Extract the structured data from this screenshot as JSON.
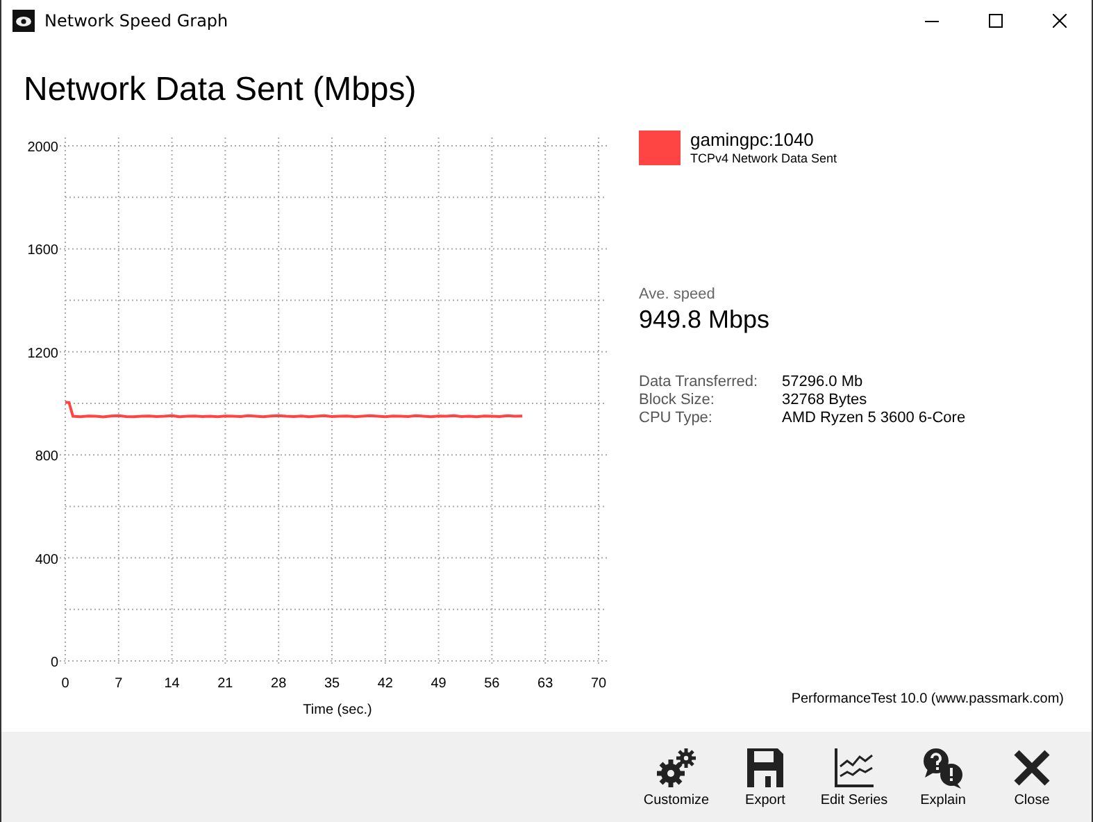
{
  "window": {
    "title": "Network Speed Graph"
  },
  "heading": "Network Data Sent (Mbps)",
  "chart": {
    "chart_data": {
      "type": "line",
      "grid": true,
      "xlabel": "Time (sec.)",
      "xlim": [
        0,
        70
      ],
      "ylim": [
        0,
        2000
      ],
      "xticks": [
        0,
        7,
        14,
        21,
        28,
        35,
        42,
        49,
        56,
        63,
        70
      ],
      "yticks": [
        0,
        400,
        800,
        1200,
        1600,
        2000
      ],
      "x": [
        0,
        0.5,
        1,
        2,
        3,
        4,
        5,
        6,
        7,
        8,
        9,
        10,
        11,
        12,
        13,
        14,
        15,
        16,
        17,
        18,
        19,
        20,
        21,
        22,
        23,
        24,
        25,
        26,
        27,
        28,
        29,
        30,
        31,
        32,
        33,
        34,
        35,
        36,
        37,
        38,
        39,
        40,
        41,
        42,
        43,
        44,
        45,
        46,
        47,
        48,
        49,
        50,
        51,
        52,
        53,
        54,
        55,
        56,
        57,
        58,
        59,
        60
      ],
      "series": [
        {
          "name": "gamingpc:1040",
          "color": "#ff4444",
          "values": [
            1005,
            1003,
            950,
            948,
            951,
            950,
            947,
            951,
            952,
            949,
            948,
            950,
            951,
            949,
            950,
            952,
            948,
            950,
            951,
            949,
            950,
            948,
            951,
            950,
            949,
            952,
            950,
            948,
            951,
            952,
            950,
            949,
            951,
            948,
            950,
            952,
            949,
            950,
            951,
            948,
            950,
            952,
            950,
            948,
            951,
            950,
            949,
            952,
            950,
            948,
            951,
            950,
            952,
            949,
            950,
            948,
            951,
            950,
            949,
            952,
            950,
            951
          ]
        }
      ]
    }
  },
  "legend": {
    "description": "TCPv4 Network Data Sent"
  },
  "average": {
    "label": "Ave. speed",
    "value": "949.8 Mbps"
  },
  "details": [
    {
      "label": "Data Transferred:",
      "value": "57296.0 Mb"
    },
    {
      "label": "Block Size:",
      "value": "32768 Bytes"
    },
    {
      "label": "CPU Type:",
      "value": "AMD Ryzen 5 3600 6-Core"
    }
  ],
  "credit": "PerformanceTest 10.0 (www.passmark.com)",
  "toolbar": [
    {
      "kind": "customize",
      "label": "Customize"
    },
    {
      "kind": "export",
      "label": "Export"
    },
    {
      "kind": "series",
      "label": "Edit Series"
    },
    {
      "kind": "explain",
      "label": "Explain"
    },
    {
      "kind": "close",
      "label": "Close"
    }
  ]
}
